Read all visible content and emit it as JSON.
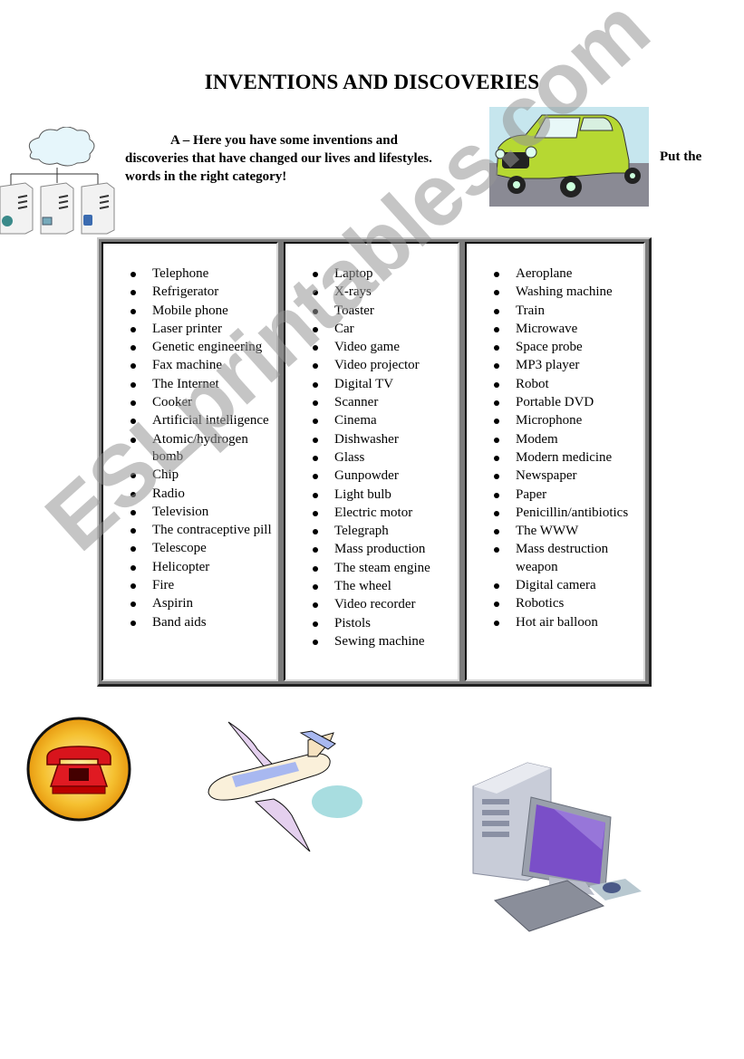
{
  "title": "INVENTIONS AND DISCOVERIES",
  "instructions": {
    "line1": "A – Here you have some inventions and",
    "line2": "discoveries that have changed our lives and lifestyles.",
    "line3": "words in the right category!",
    "tail": "Put the"
  },
  "columns": [
    {
      "items": [
        "Telephone",
        "Refrigerator",
        "Mobile phone",
        "Laser printer",
        "Genetic engineering",
        "Fax machine",
        "The Internet",
        "Cooker",
        "Artificial intelligence",
        "Atomic/hydrogen bomb",
        "Chip",
        "Radio",
        "Television",
        "The contraceptive pill",
        "Telescope",
        "Helicopter",
        "Fire",
        "Aspirin",
        "Band aids"
      ]
    },
    {
      "items": [
        "Laptop",
        "X-rays",
        "Toaster",
        "Car",
        "Video game",
        "Video projector",
        "Digital TV",
        "Scanner",
        "Cinema",
        "Dishwasher",
        "Glass",
        "Gunpowder",
        "Light bulb",
        "Electric motor",
        "Telegraph",
        "Mass production",
        "The steam engine",
        "The wheel",
        "Video recorder",
        "Pistols",
        "Sewing machine"
      ]
    },
    {
      "items": [
        "Aeroplane",
        "Washing machine",
        "Train",
        "Microwave",
        "Space probe",
        "MP3 player",
        "Robot",
        "Portable DVD",
        "Microphone",
        "Modem",
        "Modern medicine",
        "Newspaper",
        "Paper",
        "Penicillin/antibiotics",
        "The WWW",
        "Mass destruction weapon",
        "Digital camera",
        "Robotics",
        "Hot air balloon"
      ]
    }
  ],
  "images": {
    "network": "network-cloud-servers-icon",
    "car": "green-mini-car-icon",
    "phone": "red-telephone-icon",
    "plane": "aeroplane-icon",
    "computer": "desktop-computer-icon"
  },
  "watermark": "ESLprintables.com",
  "colors": {
    "car_body": "#b6d832",
    "phone_red": "#d8141c",
    "phone_circle": "#f0b020",
    "screen_purple": "#7a4fc8"
  }
}
